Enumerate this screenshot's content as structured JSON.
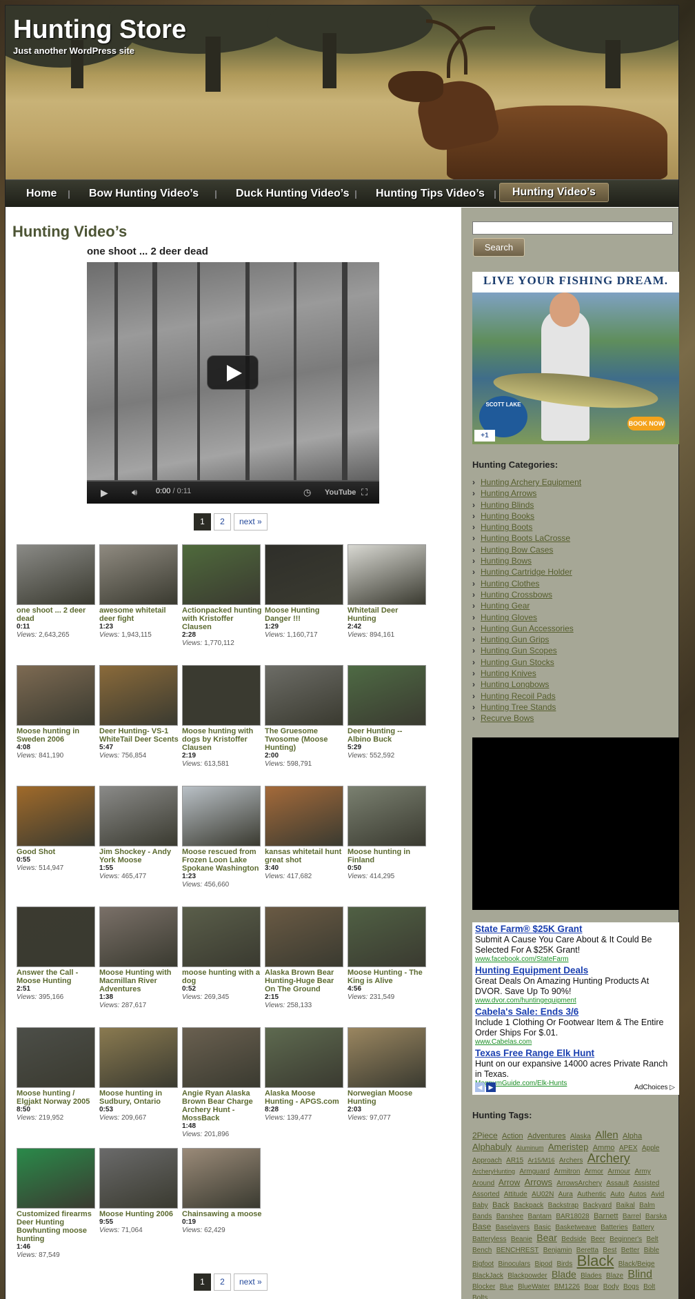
{
  "site": {
    "title": "Hunting Store",
    "description": "Just another WordPress site"
  },
  "nav": [
    {
      "label": "Home"
    },
    {
      "label": "Bow Hunting Video’s"
    },
    {
      "label": "Duck Hunting Video’s"
    },
    {
      "label": "Hunting Tips Video’s"
    },
    {
      "label": "Hunting Video’s"
    }
  ],
  "page": {
    "title": "Hunting Video’s",
    "video_title": "one shoot ... 2 deer dead"
  },
  "player": {
    "time": "0:00",
    "duration": " / 0:11",
    "youtube_label": "YouTube"
  },
  "pagination": {
    "current": "1",
    "page2": "2",
    "next": "next »"
  },
  "views_label": "Views:",
  "videos": [
    {
      "title": "one shoot ... 2 deer dead",
      "duration": "0:11",
      "views": "2,643,265"
    },
    {
      "title": "awesome whitetail deer fight",
      "duration": "1:23",
      "views": "1,943,115"
    },
    {
      "title": "Actionpacked hunting with Kristoffer Clausen",
      "duration": "2:28",
      "views": "1,770,112"
    },
    {
      "title": "Moose Hunting Danger !!!",
      "duration": "1:29",
      "views": "1,160,717"
    },
    {
      "title": "Whitetail Deer Hunting",
      "duration": "2:42",
      "views": "894,161"
    },
    {
      "title": "Moose hunting in Sweden 2006",
      "duration": "4:08",
      "views": "841,190"
    },
    {
      "title": "Deer Hunting- VS-1 WhiteTail Deer Scents",
      "duration": "5:47",
      "views": "756,854"
    },
    {
      "title": "Moose hunting with dogs by Kristoffer Clausen",
      "duration": "2:19",
      "views": "613,581"
    },
    {
      "title": "The Gruesome Twosome (Moose Hunting)",
      "duration": "2:00",
      "views": "598,791"
    },
    {
      "title": "Deer Hunting -- Albino Buck",
      "duration": "5:29",
      "views": "552,592"
    },
    {
      "title": "Good Shot",
      "duration": "0:55",
      "views": "514,947"
    },
    {
      "title": "Jim Shockey - Andy York Moose",
      "duration": "1:55",
      "views": "465,477"
    },
    {
      "title": "Moose rescued from Frozen Loon Lake Spokane Washington",
      "duration": "1:23",
      "views": "456,660"
    },
    {
      "title": "kansas whitetail hunt great shot",
      "duration": "3:40",
      "views": "417,682"
    },
    {
      "title": "Moose hunting in Finland",
      "duration": "0:50",
      "views": "414,295"
    },
    {
      "title": "Answer the Call - Moose Hunting",
      "duration": "2:51",
      "views": "395,166"
    },
    {
      "title": "Moose Hunting with Macmillan River Adventures",
      "duration": "1:38",
      "views": "287,617"
    },
    {
      "title": "moose hunting with a dog",
      "duration": "0:52",
      "views": "269,345"
    },
    {
      "title": "Alaska Brown Bear Hunting-Huge Bear On The Ground",
      "duration": "2:15",
      "views": "258,133"
    },
    {
      "title": "Moose Hunting - The King is Alive",
      "duration": "4:56",
      "views": "231,549"
    },
    {
      "title": "Moose hunting / Elgjakt Norway 2005",
      "duration": "8:50",
      "views": "219,952"
    },
    {
      "title": "Moose hunting in Sudbury, Ontario",
      "duration": "0:53",
      "views": "209,667"
    },
    {
      "title": "Angie Ryan Alaska Brown Bear Charge Archery Hunt - MossBack",
      "duration": "1:48",
      "views": "201,896"
    },
    {
      "title": "Alaska Moose Hunting - APGS.com",
      "duration": "8:28",
      "views": "139,477"
    },
    {
      "title": "Norwegian Moose Hunting",
      "duration": "2:03",
      "views": "97,077"
    },
    {
      "title": "Customized firearms Deer Hunting Bowhunting moose hunting",
      "duration": "1:46",
      "views": "87,549"
    },
    {
      "title": "Moose Hunting 2006",
      "duration": "9:55",
      "views": "71,064"
    },
    {
      "title": "Chainsawing a moose",
      "duration": "0:19",
      "views": "62,429"
    }
  ],
  "thumb_colors": [
    "#8a8a86",
    "#8f8a80",
    "#4f6a3c",
    "#2f2f2a",
    "#d8d8d2",
    "#7d6a52",
    "#8a6a3a",
    "#3a3a30",
    "#6c6c66",
    "#4e6a44",
    "#a06a2a",
    "#8a8a88",
    "#b9c0c6",
    "#a46a3a",
    "#7a8070",
    "#3b3a30",
    "#7a7068",
    "#5a5e4a",
    "#6a5a44",
    "#506044",
    "#4c4e48",
    "#8a7a50",
    "#6a6050",
    "#5e6a50",
    "#9a8660",
    "#2a8a4a",
    "#6a6a6a",
    "#9a8a78"
  ],
  "sidebar": {
    "search_button": "Search",
    "ad_headline": "LIVE YOUR FISHING DREAM.",
    "ad_logo": "SCOTT LAKE",
    "ad_book": "BOOK NOW",
    "ad_plus": "+1",
    "categories_title": "Hunting Categories:",
    "categories": [
      "Hunting Archery Equipment",
      "Hunting Arrows",
      "Hunting Blinds",
      "Hunting Books",
      "Hunting Boots",
      "Hunting Boots LaCrosse",
      "Hunting Bow Cases",
      "Hunting Bows",
      "Hunting Cartridge Holder",
      "Hunting Clothes",
      "Hunting Crossbows",
      "Hunting Gear",
      "Hunting Gloves",
      "Hunting Gun Accessories",
      "Hunting Gun Grips",
      "Hunting Gun Scopes",
      "Hunting Gun Stocks",
      "Hunting Knives",
      "Hunting Longbows",
      "Hunting Recoil Pads",
      "Hunting Tree Stands",
      "Recurve Bows"
    ],
    "text_ads": [
      {
        "title": "State Farm® $25K Grant",
        "desc": "Submit A Cause You Care About & It Could Be Selected For A $25K Grant!",
        "url": "www.facebook.com/StateFarm"
      },
      {
        "title": "Hunting Equipment Deals",
        "desc": "Great Deals On Amazing Hunting Products At DVOR. Save Up To 90%!",
        "url": "www.dvor.com/huntingequipment"
      },
      {
        "title": "Cabela's Sale: Ends 3/6",
        "desc": "Include 1 Clothing Or Footwear Item & The Entire Order Ships For $.01.",
        "url": "www.Cabelas.com"
      },
      {
        "title": "Texas Free Range Elk Hunt",
        "desc": "Hunt on our expansive 14000 acres Private Ranch in Texas.",
        "url": "MagnumGuide.com/Elk-Hunts"
      }
    ],
    "adchoices": "AdChoices",
    "tags_title": "Hunting Tags:",
    "tags": [
      {
        "t": "2Piece",
        "s": 12
      },
      {
        "t": "Action",
        "s": 11
      },
      {
        "t": "Adventures",
        "s": 11
      },
      {
        "t": "Alaska",
        "s": 10
      },
      {
        "t": "Allen",
        "s": 15
      },
      {
        "t": "Alpha",
        "s": 11
      },
      {
        "t": "Alphabuly",
        "s": 13
      },
      {
        "t": "Aluminum",
        "s": 9
      },
      {
        "t": "Ameristep",
        "s": 13
      },
      {
        "t": "Ammo",
        "s": 11
      },
      {
        "t": "APEX",
        "s": 10
      },
      {
        "t": "Apple",
        "s": 10
      },
      {
        "t": "Approach",
        "s": 10
      },
      {
        "t": "AR15",
        "s": 10
      },
      {
        "t": "Ar15/M16",
        "s": 9
      },
      {
        "t": "Archers",
        "s": 10
      },
      {
        "t": "Archery",
        "s": 18
      },
      {
        "t": "ArcheryHunting",
        "s": 9
      },
      {
        "t": "Armguard",
        "s": 10
      },
      {
        "t": "Armitron",
        "s": 10
      },
      {
        "t": "Armor",
        "s": 10
      },
      {
        "t": "Armour",
        "s": 10
      },
      {
        "t": "Army",
        "s": 10
      },
      {
        "t": "Around",
        "s": 10
      },
      {
        "t": "Arrow",
        "s": 12
      },
      {
        "t": "Arrows",
        "s": 13
      },
      {
        "t": "ArrowsArchery",
        "s": 10
      },
      {
        "t": "Assault",
        "s": 10
      },
      {
        "t": "Assisted",
        "s": 10
      },
      {
        "t": "Assorted",
        "s": 10
      },
      {
        "t": "Attitude",
        "s": 10
      },
      {
        "t": "AU02N",
        "s": 10
      },
      {
        "t": "Aura",
        "s": 10
      },
      {
        "t": "Authentic",
        "s": 10
      },
      {
        "t": "Auto",
        "s": 10
      },
      {
        "t": "Autos",
        "s": 10
      },
      {
        "t": "Avid",
        "s": 10
      },
      {
        "t": "Baby",
        "s": 10
      },
      {
        "t": "Back",
        "s": 11
      },
      {
        "t": "Backpack",
        "s": 10
      },
      {
        "t": "Backstrap",
        "s": 10
      },
      {
        "t": "Backyard",
        "s": 10
      },
      {
        "t": "Baikal",
        "s": 10
      },
      {
        "t": "Balm",
        "s": 10
      },
      {
        "t": "Bands",
        "s": 10
      },
      {
        "t": "Banshee",
        "s": 10
      },
      {
        "t": "Bantam",
        "s": 10
      },
      {
        "t": "BAR18028",
        "s": 10
      },
      {
        "t": "Barnett",
        "s": 11
      },
      {
        "t": "Barrel",
        "s": 10
      },
      {
        "t": "Barska",
        "s": 10
      },
      {
        "t": "Base",
        "s": 12
      },
      {
        "t": "Baselayers",
        "s": 10
      },
      {
        "t": "Basic",
        "s": 10
      },
      {
        "t": "Basketweave",
        "s": 10
      },
      {
        "t": "Batteries",
        "s": 10
      },
      {
        "t": "Battery",
        "s": 10
      },
      {
        "t": "Batteryless",
        "s": 10
      },
      {
        "t": "Beanie",
        "s": 10
      },
      {
        "t": "Bear",
        "s": 14
      },
      {
        "t": "Bedside",
        "s": 10
      },
      {
        "t": "Beer",
        "s": 10
      },
      {
        "t": "Beginner's",
        "s": 10
      },
      {
        "t": "Belt",
        "s": 10
      },
      {
        "t": "Bench",
        "s": 10
      },
      {
        "t": "BENCHREST",
        "s": 10
      },
      {
        "t": "Benjamin",
        "s": 10
      },
      {
        "t": "Beretta",
        "s": 10
      },
      {
        "t": "Best",
        "s": 10
      },
      {
        "t": "Better",
        "s": 10
      },
      {
        "t": "Bible",
        "s": 10
      },
      {
        "t": "Bigfoot",
        "s": 10
      },
      {
        "t": "Binoculars",
        "s": 10
      },
      {
        "t": "Bipod",
        "s": 10
      },
      {
        "t": "Birds",
        "s": 10
      },
      {
        "t": "Black",
        "s": 22
      },
      {
        "t": "Black/Beige",
        "s": 10
      },
      {
        "t": "BlackJack",
        "s": 10
      },
      {
        "t": "Blackpowder",
        "s": 10
      },
      {
        "t": "Blade",
        "s": 14
      },
      {
        "t": "Blades",
        "s": 10
      },
      {
        "t": "Blaze",
        "s": 10
      },
      {
        "t": "Blind",
        "s": 16
      },
      {
        "t": "Blocker",
        "s": 10
      },
      {
        "t": "Blue",
        "s": 10
      },
      {
        "t": "BlueWater",
        "s": 10
      },
      {
        "t": "BM1226",
        "s": 10
      },
      {
        "t": "Boar",
        "s": 10
      },
      {
        "t": "Body",
        "s": 10
      },
      {
        "t": "Bogs",
        "s": 10
      },
      {
        "t": "Bolt",
        "s": 10
      },
      {
        "t": "Bolts",
        "s": 10
      }
    ]
  }
}
